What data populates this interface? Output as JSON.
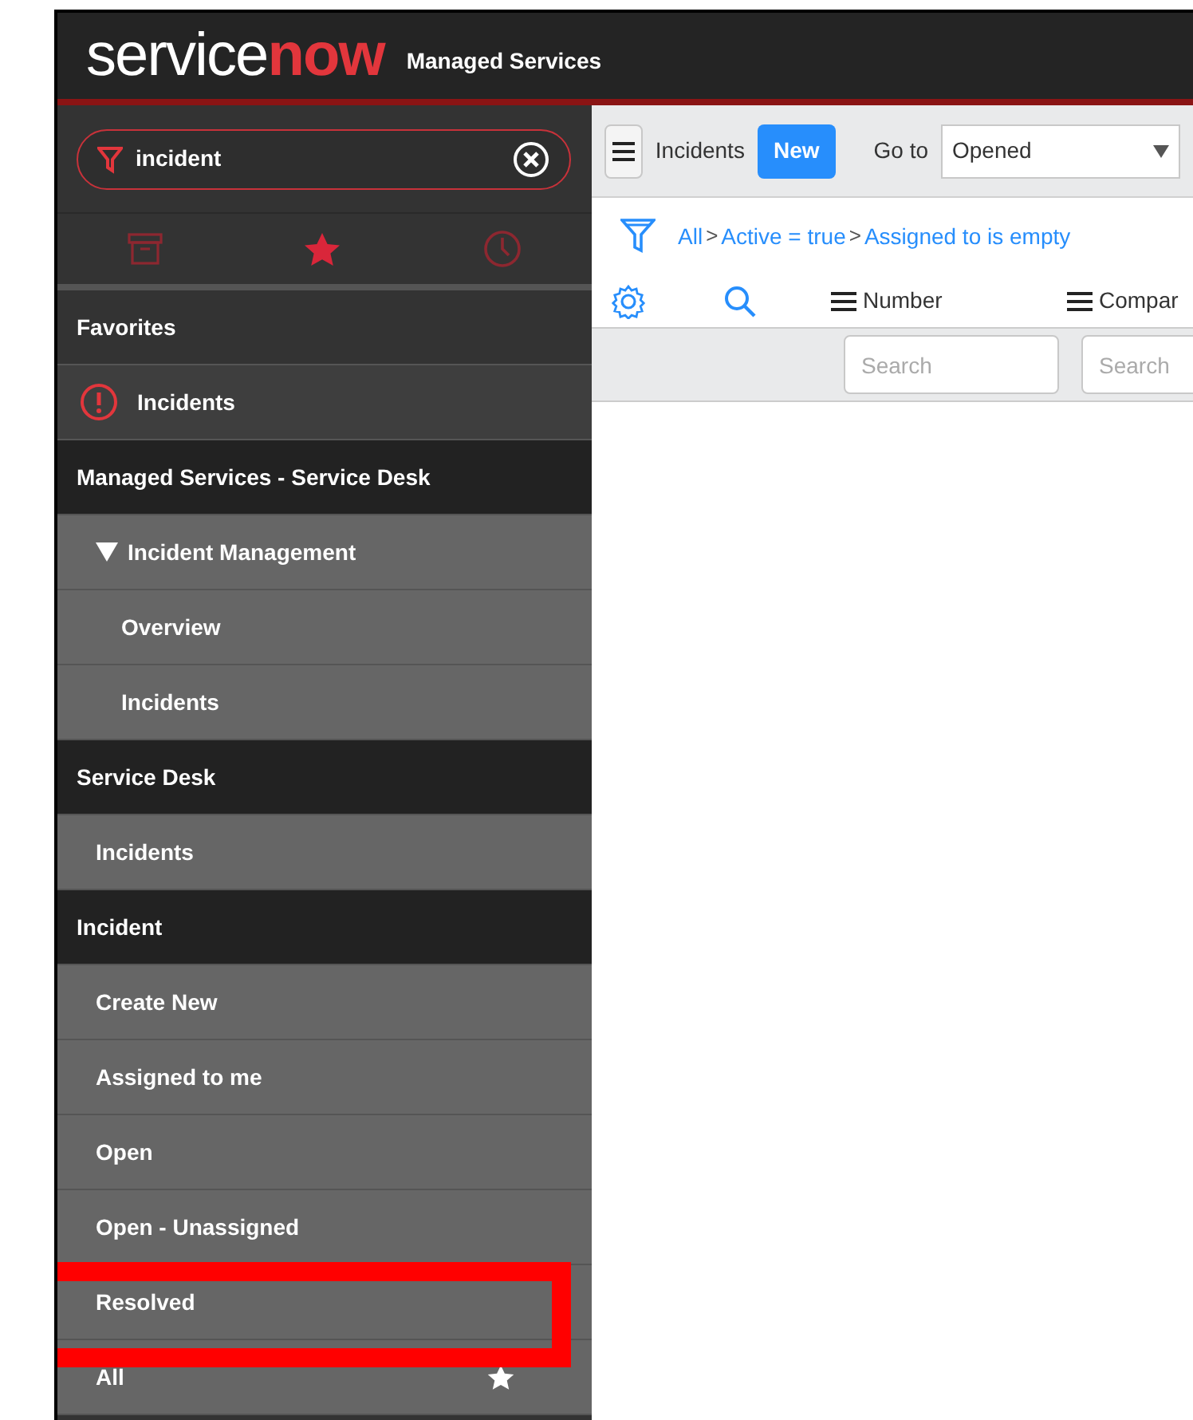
{
  "header": {
    "logo_primary": "service",
    "logo_accent": "now",
    "title": "Managed Services"
  },
  "navigator": {
    "filter": {
      "value": "incident"
    },
    "tabs": [
      {
        "kind": "archive",
        "selected": false
      },
      {
        "kind": "star",
        "selected": true
      },
      {
        "kind": "history",
        "selected": false
      }
    ],
    "sections": [
      {
        "title": "Favorites",
        "kind": "favorites",
        "items": [
          {
            "label": "Incidents",
            "kind": "alert"
          }
        ]
      },
      {
        "title": "Managed Services - Service Desk",
        "kind": "application",
        "items": [
          {
            "label": "Incident Management",
            "kind": "folder",
            "expanded": true,
            "children": [
              {
                "label": "Overview",
                "kind": "module"
              },
              {
                "label": "Incidents",
                "kind": "module"
              }
            ]
          }
        ]
      },
      {
        "title": "Service Desk",
        "kind": "application",
        "items": [
          {
            "label": "Incidents",
            "kind": "module"
          }
        ]
      },
      {
        "title": "Incident",
        "kind": "application",
        "items": [
          {
            "label": "Create New",
            "kind": "module"
          },
          {
            "label": "Assigned to me",
            "kind": "module"
          },
          {
            "label": "Open",
            "kind": "module"
          },
          {
            "label": "Open - Unassigned",
            "kind": "module"
          },
          {
            "label": "Resolved",
            "kind": "module",
            "highlighted": true
          },
          {
            "label": "All",
            "kind": "module",
            "starred": true
          }
        ]
      }
    ]
  },
  "list": {
    "title": "Incidents",
    "new_button": "New",
    "goto_label": "Go to",
    "goto_value": "Opened",
    "breadcrumbs": [
      "All",
      "Active = true",
      "Assigned to is empty"
    ],
    "breadcrumb_separator": ">",
    "columns": [
      {
        "label": "Number",
        "search_placeholder": "Search"
      },
      {
        "label": "Compar",
        "search_placeholder": "Search"
      }
    ]
  }
}
